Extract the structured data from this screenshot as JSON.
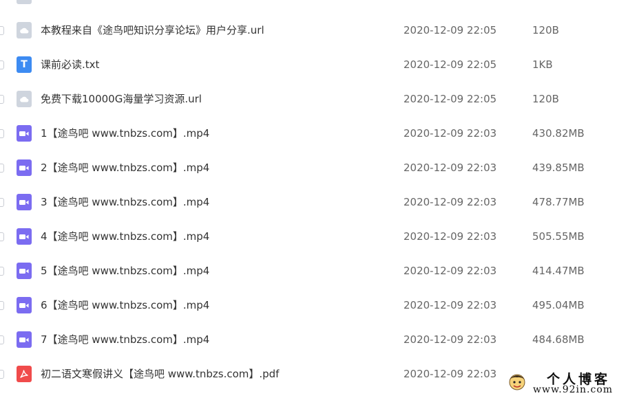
{
  "files": [
    {
      "name": "本教程来自《途鸟吧知识分享论坛》用户分享.url",
      "date": "2020-12-09 22:05",
      "size": "120B",
      "type": "url",
      "icon": "link-file-icon"
    },
    {
      "name": "课前必读.txt",
      "date": "2020-12-09 22:05",
      "size": "1KB",
      "type": "txt",
      "icon": "text-file-icon",
      "glyph": "T"
    },
    {
      "name": "免费下载10000G海量学习资源.url",
      "date": "2020-12-09 22:05",
      "size": "120B",
      "type": "url",
      "icon": "link-file-icon"
    },
    {
      "name": "1【途鸟吧 www.tnbzs.com】.mp4",
      "date": "2020-12-09 22:03",
      "size": "430.82MB",
      "type": "video",
      "icon": "video-file-icon"
    },
    {
      "name": "2【途鸟吧 www.tnbzs.com】.mp4",
      "date": "2020-12-09 22:03",
      "size": "439.85MB",
      "type": "video",
      "icon": "video-file-icon"
    },
    {
      "name": "3【途鸟吧 www.tnbzs.com】.mp4",
      "date": "2020-12-09 22:03",
      "size": "478.77MB",
      "type": "video",
      "icon": "video-file-icon"
    },
    {
      "name": "4【途鸟吧 www.tnbzs.com】.mp4",
      "date": "2020-12-09 22:03",
      "size": "505.55MB",
      "type": "video",
      "icon": "video-file-icon"
    },
    {
      "name": "5【途鸟吧 www.tnbzs.com】.mp4",
      "date": "2020-12-09 22:03",
      "size": "414.47MB",
      "type": "video",
      "icon": "video-file-icon"
    },
    {
      "name": "6【途鸟吧 www.tnbzs.com】.mp4",
      "date": "2020-12-09 22:03",
      "size": "495.04MB",
      "type": "video",
      "icon": "video-file-icon"
    },
    {
      "name": "7【途鸟吧 www.tnbzs.com】.mp4",
      "date": "2020-12-09 22:03",
      "size": "484.68MB",
      "type": "video",
      "icon": "video-file-icon"
    },
    {
      "name": "初二语文寒假讲义【途鸟吧 www.tnbzs.com】.pdf",
      "date": "2020-12-09 22:03",
      "size": "",
      "type": "pdf",
      "icon": "pdf-file-icon"
    }
  ],
  "watermark": {
    "title": "个人博客",
    "url": "www.92in.com"
  },
  "colors": {
    "url_icon": "#cfd5de",
    "txt_icon": "#3d8bf2",
    "video_icon": "#7b6cf1",
    "pdf_icon": "#f04b4b"
  }
}
